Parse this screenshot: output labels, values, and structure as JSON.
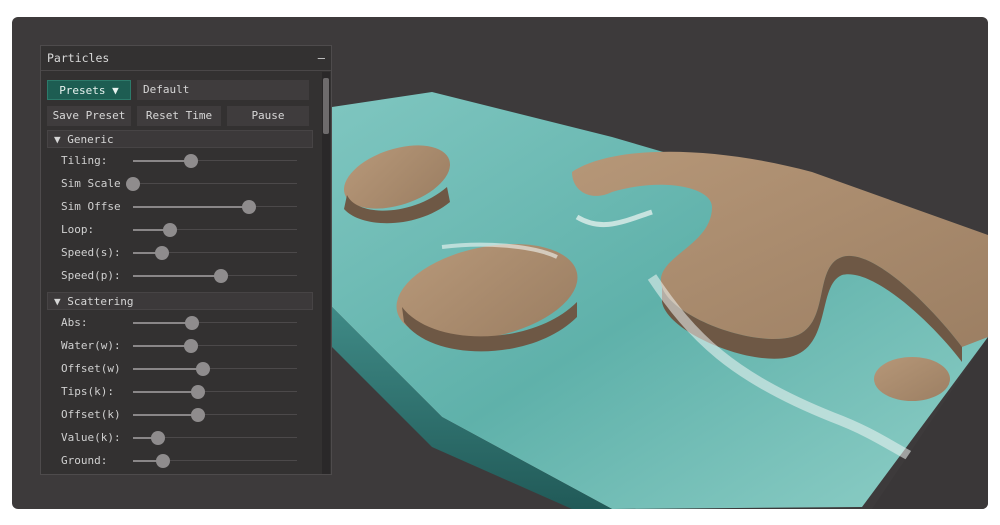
{
  "panel": {
    "title": "Particles",
    "collapse_glyph": "–",
    "presets_label": "Presets",
    "presets_caret": "▼",
    "preset_value": "Default",
    "save_preset_label": "Save Preset",
    "reset_time_label": "Reset Time",
    "pause_label": "Pause"
  },
  "sections": [
    {
      "title": "▼ Generic",
      "sliders": [
        {
          "label": "Tiling:",
          "value": 0.42
        },
        {
          "label": "Sim Scale",
          "value": 0.0
        },
        {
          "label": "Sim Offse",
          "value": 0.84
        },
        {
          "label": "Loop:",
          "value": 0.27
        },
        {
          "label": "Speed(s):",
          "value": 0.21
        },
        {
          "label": "Speed(p):",
          "value": 0.64
        }
      ]
    },
    {
      "title": "▼ Scattering",
      "sliders": [
        {
          "label": "Abs:",
          "value": 0.43
        },
        {
          "label": "Water(w):",
          "value": 0.42
        },
        {
          "label": "Offset(w)",
          "value": 0.51
        },
        {
          "label": "Tips(k):",
          "value": 0.47
        },
        {
          "label": "Offset(k)",
          "value": 0.47
        },
        {
          "label": "Value(k):",
          "value": 0.18
        },
        {
          "label": "Ground:",
          "value": 0.22
        }
      ]
    }
  ],
  "colors": {
    "accent": "#1d5d52",
    "background": "#3d3a3b",
    "sand": "#a8896b",
    "water": "#5fb3ad"
  }
}
